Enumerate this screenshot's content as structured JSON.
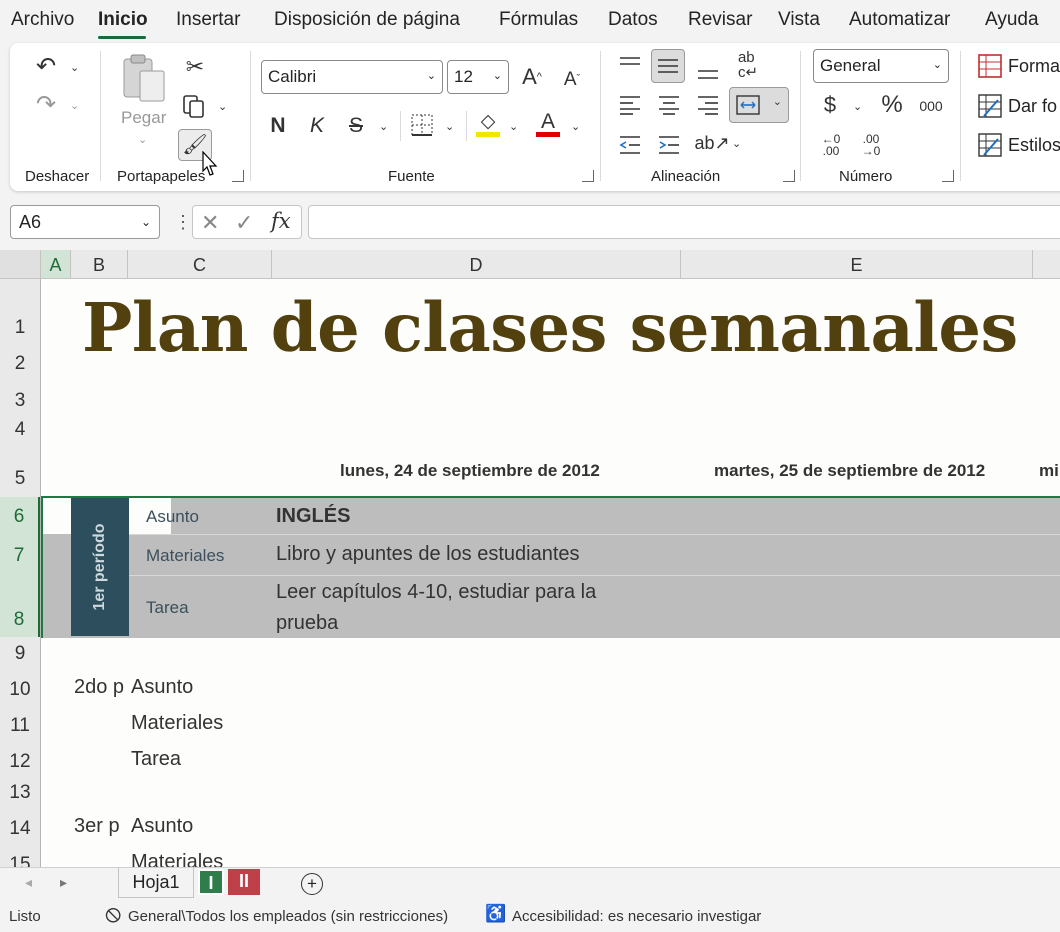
{
  "menu": {
    "items": [
      "Archivo",
      "Inicio",
      "Insertar",
      "Disposición de página",
      "Fórmulas",
      "Datos",
      "Revisar",
      "Vista",
      "Automatizar",
      "Ayuda"
    ],
    "active": "Inicio"
  },
  "ribbon": {
    "groups": {
      "undo": "Deshacer",
      "clipboard": "Portapapeles",
      "font": "Fuente",
      "alignment": "Alineación",
      "number": "Número"
    },
    "paste_label": "Pegar",
    "font_name": "Calibri",
    "font_size": "12",
    "bold_glyph": "N",
    "italic_glyph": "K",
    "strike_glyph": "S",
    "number_format": "General",
    "styles": {
      "conditional": "Forma",
      "as_table": "Dar fo",
      "cell_styles": "Estilos"
    },
    "fill_color": "#f2e600",
    "font_color": "#e00000"
  },
  "formula_bar": {
    "name_box": "A6",
    "formula": ""
  },
  "columns": [
    "A",
    "B",
    "C",
    "D",
    "E"
  ],
  "rows": [
    "1",
    "2",
    "3",
    "4",
    "5",
    "6",
    "7",
    "8",
    "9",
    "10",
    "11",
    "12",
    "13",
    "14",
    "15"
  ],
  "sheet": {
    "title": "Plan de clases semanales",
    "date_d": "lunes, 24 de septiembre de 2012",
    "date_e": "martes, 25 de septiembre de 2012",
    "date_f_partial": "mi",
    "period1": {
      "label": "1er período",
      "subject_label": "Asunto",
      "subject_value": "INGLÉS",
      "materials_label": "Materiales",
      "materials_value": "Libro y apuntes de los estudiantes",
      "homework_label": "Tarea",
      "homework_value_line1": "Leer capítulos 4-10, estudiar para la",
      "homework_value_line2": "prueba"
    },
    "period2": {
      "label_partial": "2do p",
      "subject_label": "Asunto",
      "materials_label": "Materiales",
      "homework_label": "Tarea"
    },
    "period3": {
      "label_partial": "3er p",
      "subject_label": "Asunto",
      "materials_label": "Materiales"
    }
  },
  "tabs": {
    "sheet1": "Hoja1",
    "tab2": "I",
    "tab3": "II",
    "tab2_color": "#2e7d4a",
    "tab3_color": "#c0404a"
  },
  "status": {
    "ready": "Listo",
    "sensitivity": "General\\Todos los empleados (sin restricciones)",
    "accessibility": "Accesibilidad: es necesario investigar"
  }
}
